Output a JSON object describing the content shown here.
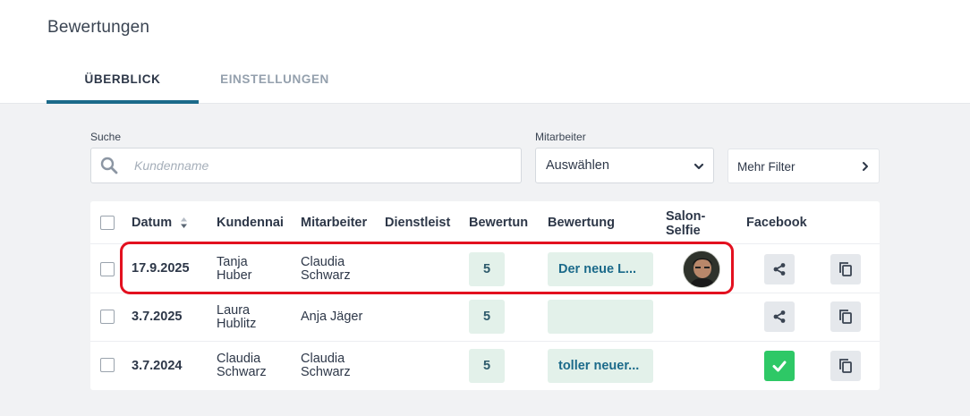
{
  "header": {
    "title": "Bewertungen",
    "tabs": [
      {
        "label": "ÜBERBLICK",
        "active": true
      },
      {
        "label": "EINSTELLUNGEN",
        "active": false
      }
    ]
  },
  "filters": {
    "search": {
      "label": "Suche",
      "placeholder": "Kundenname",
      "value": "",
      "icon": "search-icon"
    },
    "employee": {
      "label": "Mitarbeiter",
      "selected": "Auswählen",
      "icon": "chevron-down-icon"
    },
    "more": {
      "label": "Mehr Filter",
      "icon": "chevron-right-icon"
    }
  },
  "table": {
    "columns": [
      "Datum",
      "Kundenname",
      "Mitarbeiter",
      "Dienstleistung",
      "Bewertung",
      "Bewertung",
      "Salon-Selfie",
      "Facebook"
    ],
    "column_display": [
      "Datum",
      "Kundennai",
      "Mitarbeiter",
      "Dienstleist",
      "Bewertun",
      "Bewertung",
      "Salon-\nSelfie",
      "Facebook"
    ],
    "sort_icon": "sort-updown-icon",
    "rows": [
      {
        "date": "17.9.2025",
        "customer": [
          "Tanja",
          "Huber"
        ],
        "employee": [
          "Claudia",
          "Schwarz"
        ],
        "service": "",
        "score": "5",
        "review": "Der neue L...",
        "selfie": true,
        "facebook": "share-icon",
        "copy": "copy-icon",
        "highlighted": true
      },
      {
        "date": "3.7.2025",
        "customer": [
          "Laura",
          "Hublitz"
        ],
        "employee": [
          "Anja Jäger"
        ],
        "service": "",
        "score": "5",
        "review": "",
        "selfie": false,
        "facebook": "share-icon",
        "copy": "copy-icon",
        "highlighted": false
      },
      {
        "date": "3.7.2024",
        "customer": [
          "Claudia",
          "Schwarz"
        ],
        "employee": [
          "Claudia",
          "Schwarz"
        ],
        "service": "",
        "score": "5",
        "review": "toller neuer...",
        "selfie": false,
        "facebook": "check-icon",
        "copy": "copy-icon",
        "highlighted": false
      }
    ]
  },
  "colors": {
    "accent": "#1b6a8a",
    "badge_bg": "#e3f1ea",
    "success": "#2ec866",
    "highlight": "#e3101f"
  }
}
